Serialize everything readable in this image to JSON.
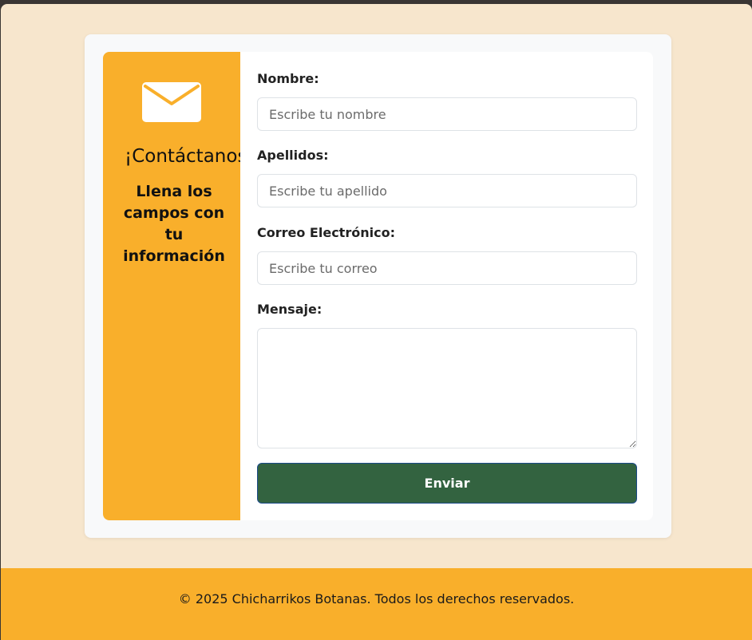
{
  "contact_panel": {
    "icon": "envelope-icon",
    "title": "¡Contáctanos!",
    "subtitle": "Llena los campos con tu información"
  },
  "form": {
    "nombre": {
      "label": "Nombre:",
      "placeholder": "Escribe tu nombre",
      "value": ""
    },
    "apellidos": {
      "label": "Apellidos:",
      "placeholder": "Escribe tu apellido",
      "value": ""
    },
    "correo": {
      "label": "Correo Electrónico:",
      "placeholder": "Escribe tu correo",
      "value": ""
    },
    "mensaje": {
      "label": "Mensaje:",
      "value": ""
    },
    "submit_label": "Enviar"
  },
  "footer": {
    "text": "© 2025 Chicharrikos Botanas. Todos los derechos reservados."
  },
  "colors": {
    "page_background": "#f7e6cd",
    "accent": "#f9af2b",
    "button": "#336340"
  }
}
